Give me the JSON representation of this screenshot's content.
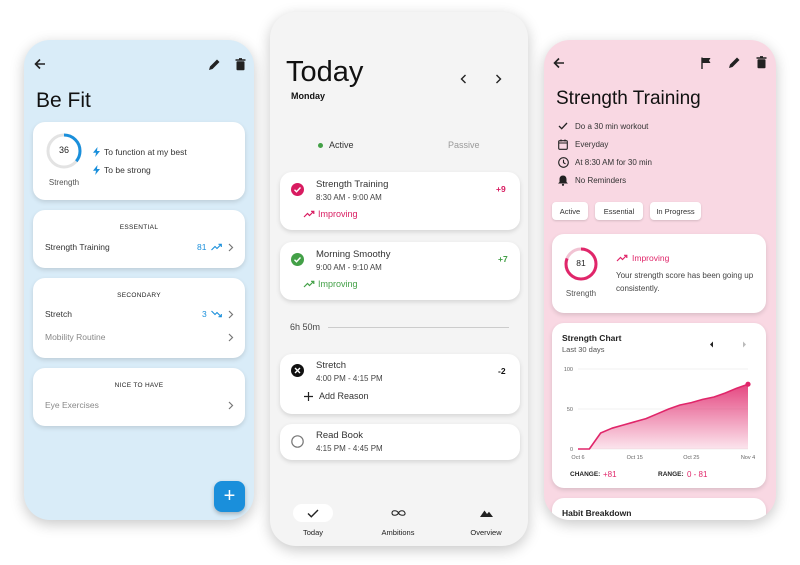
{
  "phone1": {
    "title": "Be Fit",
    "score": {
      "value": "36",
      "label": "Strength"
    },
    "reasons": [
      "To function at my best",
      "To be strong"
    ],
    "sections": [
      {
        "header": "ESSENTIAL",
        "items": [
          {
            "name": "Strength Training",
            "value": "81",
            "trend": "up"
          }
        ]
      },
      {
        "header": "SECONDARY",
        "items": [
          {
            "name": "Stretch",
            "value": "3",
            "trend": "down"
          },
          {
            "name": "Mobility Routine",
            "value": "",
            "trend": ""
          }
        ]
      },
      {
        "header": "NICE TO HAVE",
        "items": [
          {
            "name": "Eye Exercises",
            "value": "",
            "trend": ""
          }
        ]
      }
    ],
    "fab_label": "+",
    "accent": "#1a8fdb"
  },
  "phone2": {
    "title": "Today",
    "subtitle": "Monday",
    "tabs": {
      "active": "Active",
      "passive": "Passive"
    },
    "habits": [
      {
        "name": "Strength Training",
        "time": "8:30 AM - 9:00 AM",
        "status": "Improving",
        "delta": "+9",
        "color": "#d81b60"
      },
      {
        "name": "Morning Smoothy",
        "time": "9:00 AM - 9:10 AM",
        "status": "Improving",
        "delta": "+7",
        "color": "#43a047"
      }
    ],
    "gap": "6h 50m",
    "stretch": {
      "name": "Stretch",
      "time": "4:00 PM - 4:15 PM",
      "action": "Add Reason",
      "delta": "-2"
    },
    "readbook": {
      "name": "Read Book",
      "time": "4:15 PM - 4:45 PM"
    },
    "nav": [
      "Today",
      "Ambitions",
      "Overview"
    ]
  },
  "phone3": {
    "title": "Strength Training",
    "details": [
      "Do a 30 min workout",
      "Everyday",
      "At 8:30 AM for 30 min",
      "No Reminders"
    ],
    "pills": [
      "Active",
      "Essential",
      "In Progress"
    ],
    "score": {
      "value": "81",
      "label": "Strength",
      "status": "Improving",
      "description": "Your strength score has been going up consistently."
    },
    "chart_title": "Strength Chart",
    "chart_subtitle": "Last 30 days",
    "change_label": "CHANGE:",
    "change_value": "+81",
    "range_label": "RANGE:",
    "range_value": "0 - 81",
    "breakdown_title": "Habit Breakdown",
    "accent": "#e0266a"
  },
  "chart_data": {
    "type": "area",
    "title": "Strength Chart",
    "subtitle": "Last 30 days",
    "x": [
      "Oct 6",
      "Oct 8",
      "Oct 10",
      "Oct 12",
      "Oct 14",
      "Oct 16",
      "Oct 18",
      "Oct 20",
      "Oct 22",
      "Oct 24",
      "Oct 26",
      "Oct 28",
      "Oct 30",
      "Nov 1",
      "Nov 3",
      "Nov 4"
    ],
    "xticks": [
      "Oct 6",
      "Oct 15",
      "Oct 25",
      "Nov 4"
    ],
    "y": [
      0,
      0,
      20,
      26,
      30,
      34,
      38,
      44,
      50,
      55,
      58,
      62,
      65,
      70,
      76,
      81
    ],
    "ylim": [
      0,
      100
    ],
    "yticks": [
      "0",
      "50",
      "100"
    ],
    "color": "#e0266a"
  }
}
